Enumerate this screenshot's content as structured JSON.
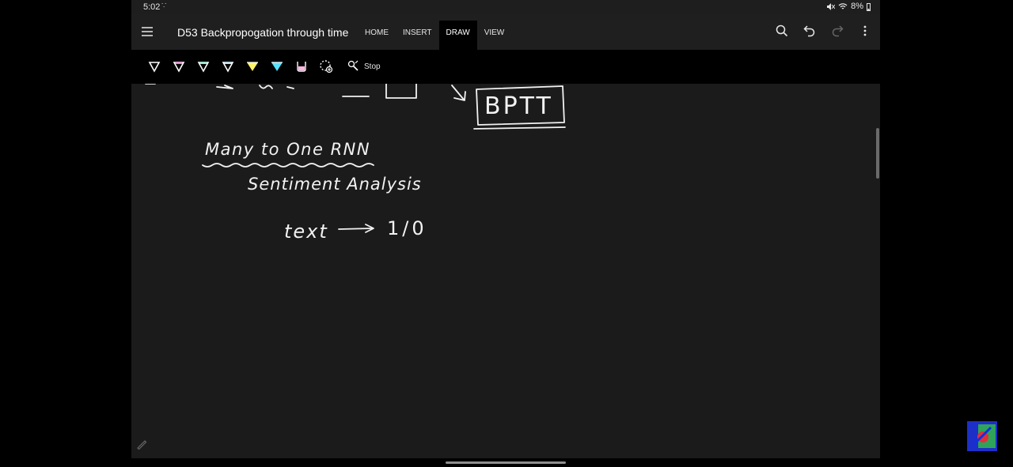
{
  "status_bar": {
    "time": "5:02",
    "extra_dots": "∵",
    "battery": "8%"
  },
  "app_bar": {
    "title": "D53 Backpropogation through time",
    "tabs": [
      {
        "label": "HOME",
        "active": false
      },
      {
        "label": "INSERT",
        "active": false
      },
      {
        "label": "DRAW",
        "active": true
      },
      {
        "label": "VIEW",
        "active": false
      }
    ],
    "icons": [
      "menu-icon",
      "search-icon",
      "undo-icon",
      "redo-icon",
      "more-icon"
    ]
  },
  "toolbar": {
    "pens": [
      {
        "name": "pen-white",
        "color": "#ffffff"
      },
      {
        "name": "pen-pink",
        "color": "#ff7de0"
      },
      {
        "name": "pen-teal",
        "color": "#7fffd4"
      },
      {
        "name": "pen-lightblue",
        "color": "#b9e8ff"
      },
      {
        "name": "highlighter-yellow",
        "color": "#fff36a"
      },
      {
        "name": "highlighter-cyan",
        "color": "#57e3ff"
      },
      {
        "name": "highlighter-pink",
        "color": "#ffb6e6"
      }
    ],
    "stop_label": "Stop"
  },
  "canvas": {
    "ink_text": {
      "bptt": "BPTT",
      "heading": "Many to One RNN",
      "subheading": "Sentiment Analysis",
      "text_word": "text",
      "output": "1/0"
    }
  },
  "colors": {
    "device_bg": "#1b1b1b",
    "ink": "#ffffff",
    "page_bg": "#000000"
  }
}
